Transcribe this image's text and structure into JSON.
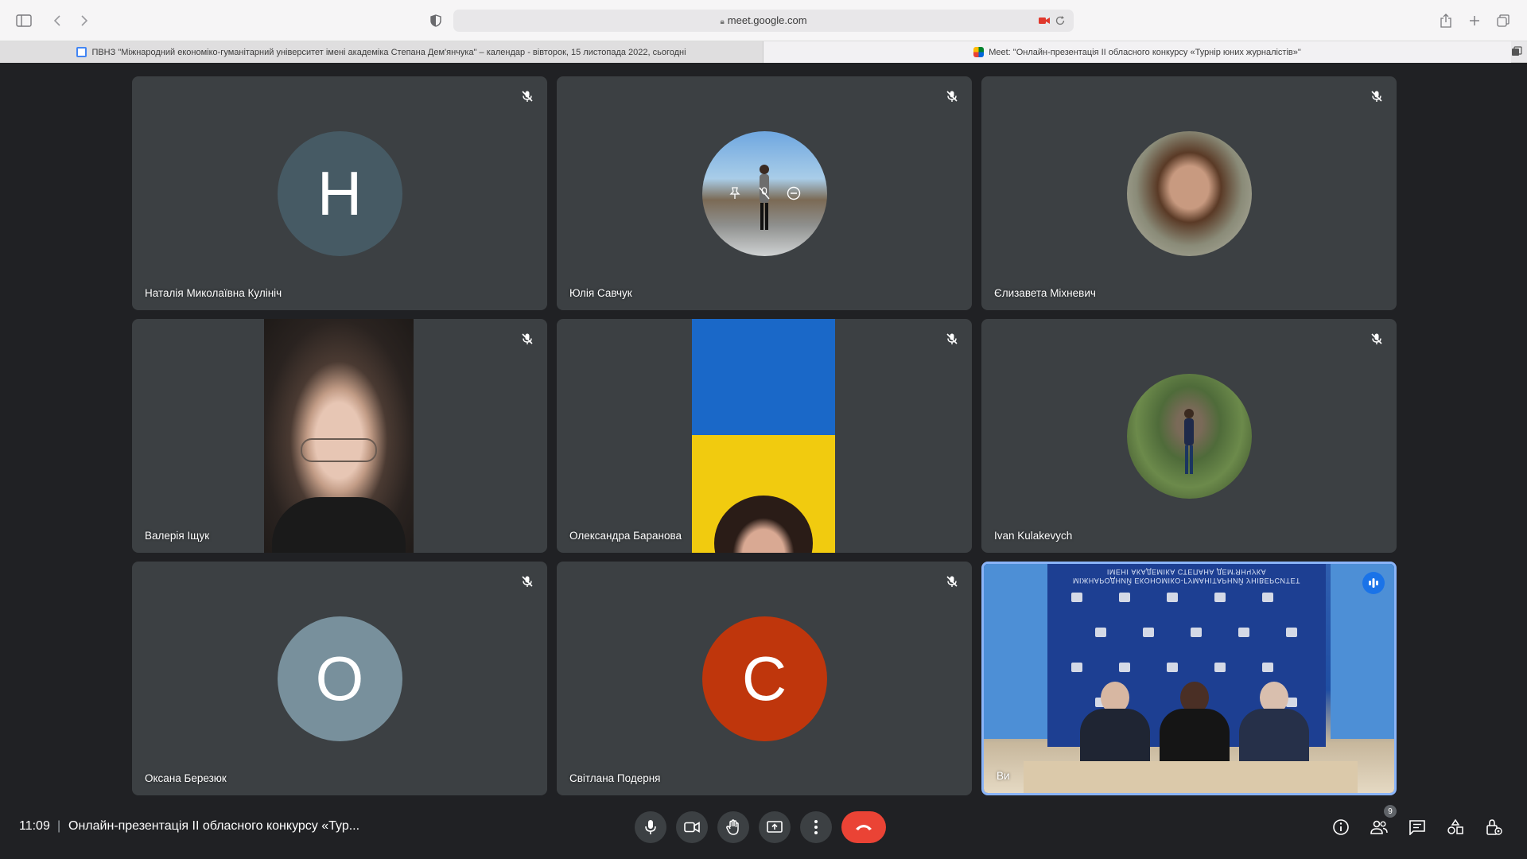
{
  "browser": {
    "url": "meet.google.com",
    "tabs": [
      {
        "label": "ПВНЗ \"Міжнародний економіко-гуманітарний університет імені академіка Степана Дем'янчука\" – календар - вівторок, 15 листопада 2022, сьогодні",
        "icon": "google-calendar-icon"
      },
      {
        "label": "Meet: \"Онлайн-презентація ІІ обласного конкурсу «Турнір юних журналістів»\"",
        "icon": "google-meet-icon"
      }
    ]
  },
  "participants": [
    {
      "name": "Наталія Миколаївна Кулініч",
      "initial": "Н",
      "muted": true
    },
    {
      "name": "Юлія Савчук",
      "muted": true
    },
    {
      "name": "Єлизавета Міхневич",
      "muted": true
    },
    {
      "name": "Валерія Іщук",
      "muted": true
    },
    {
      "name": "Олександра Баранова",
      "muted": true
    },
    {
      "name": "Ivan Kulakevych",
      "muted": true
    },
    {
      "name": "Оксана Березюк",
      "initial": "О",
      "muted": true
    },
    {
      "name": "Світлана Подерня",
      "initial": "С",
      "muted": true
    },
    {
      "name": "Ви",
      "speaking": true
    }
  ],
  "self_backdrop_text": "МІЖНАРОДНИЙ ЕКОНОМІКО-ГУМАНІТАРНИЙ УНІВЕРСИТЕТ\nІМЕНІ АКАДЕМІКА СТЕПАНА ДЕМ'ЯНЧУКА",
  "bottom": {
    "time": "11:09",
    "separator": "|",
    "meeting_title": "Онлайн-презентація ІІ обласного конкурсу «Тур...",
    "participant_count": "9"
  },
  "colors": {
    "background": "#202124",
    "tile": "#3c4043",
    "end_call": "#ea4335",
    "accent": "#8ab4f8",
    "speaking": "#1a73e8"
  }
}
